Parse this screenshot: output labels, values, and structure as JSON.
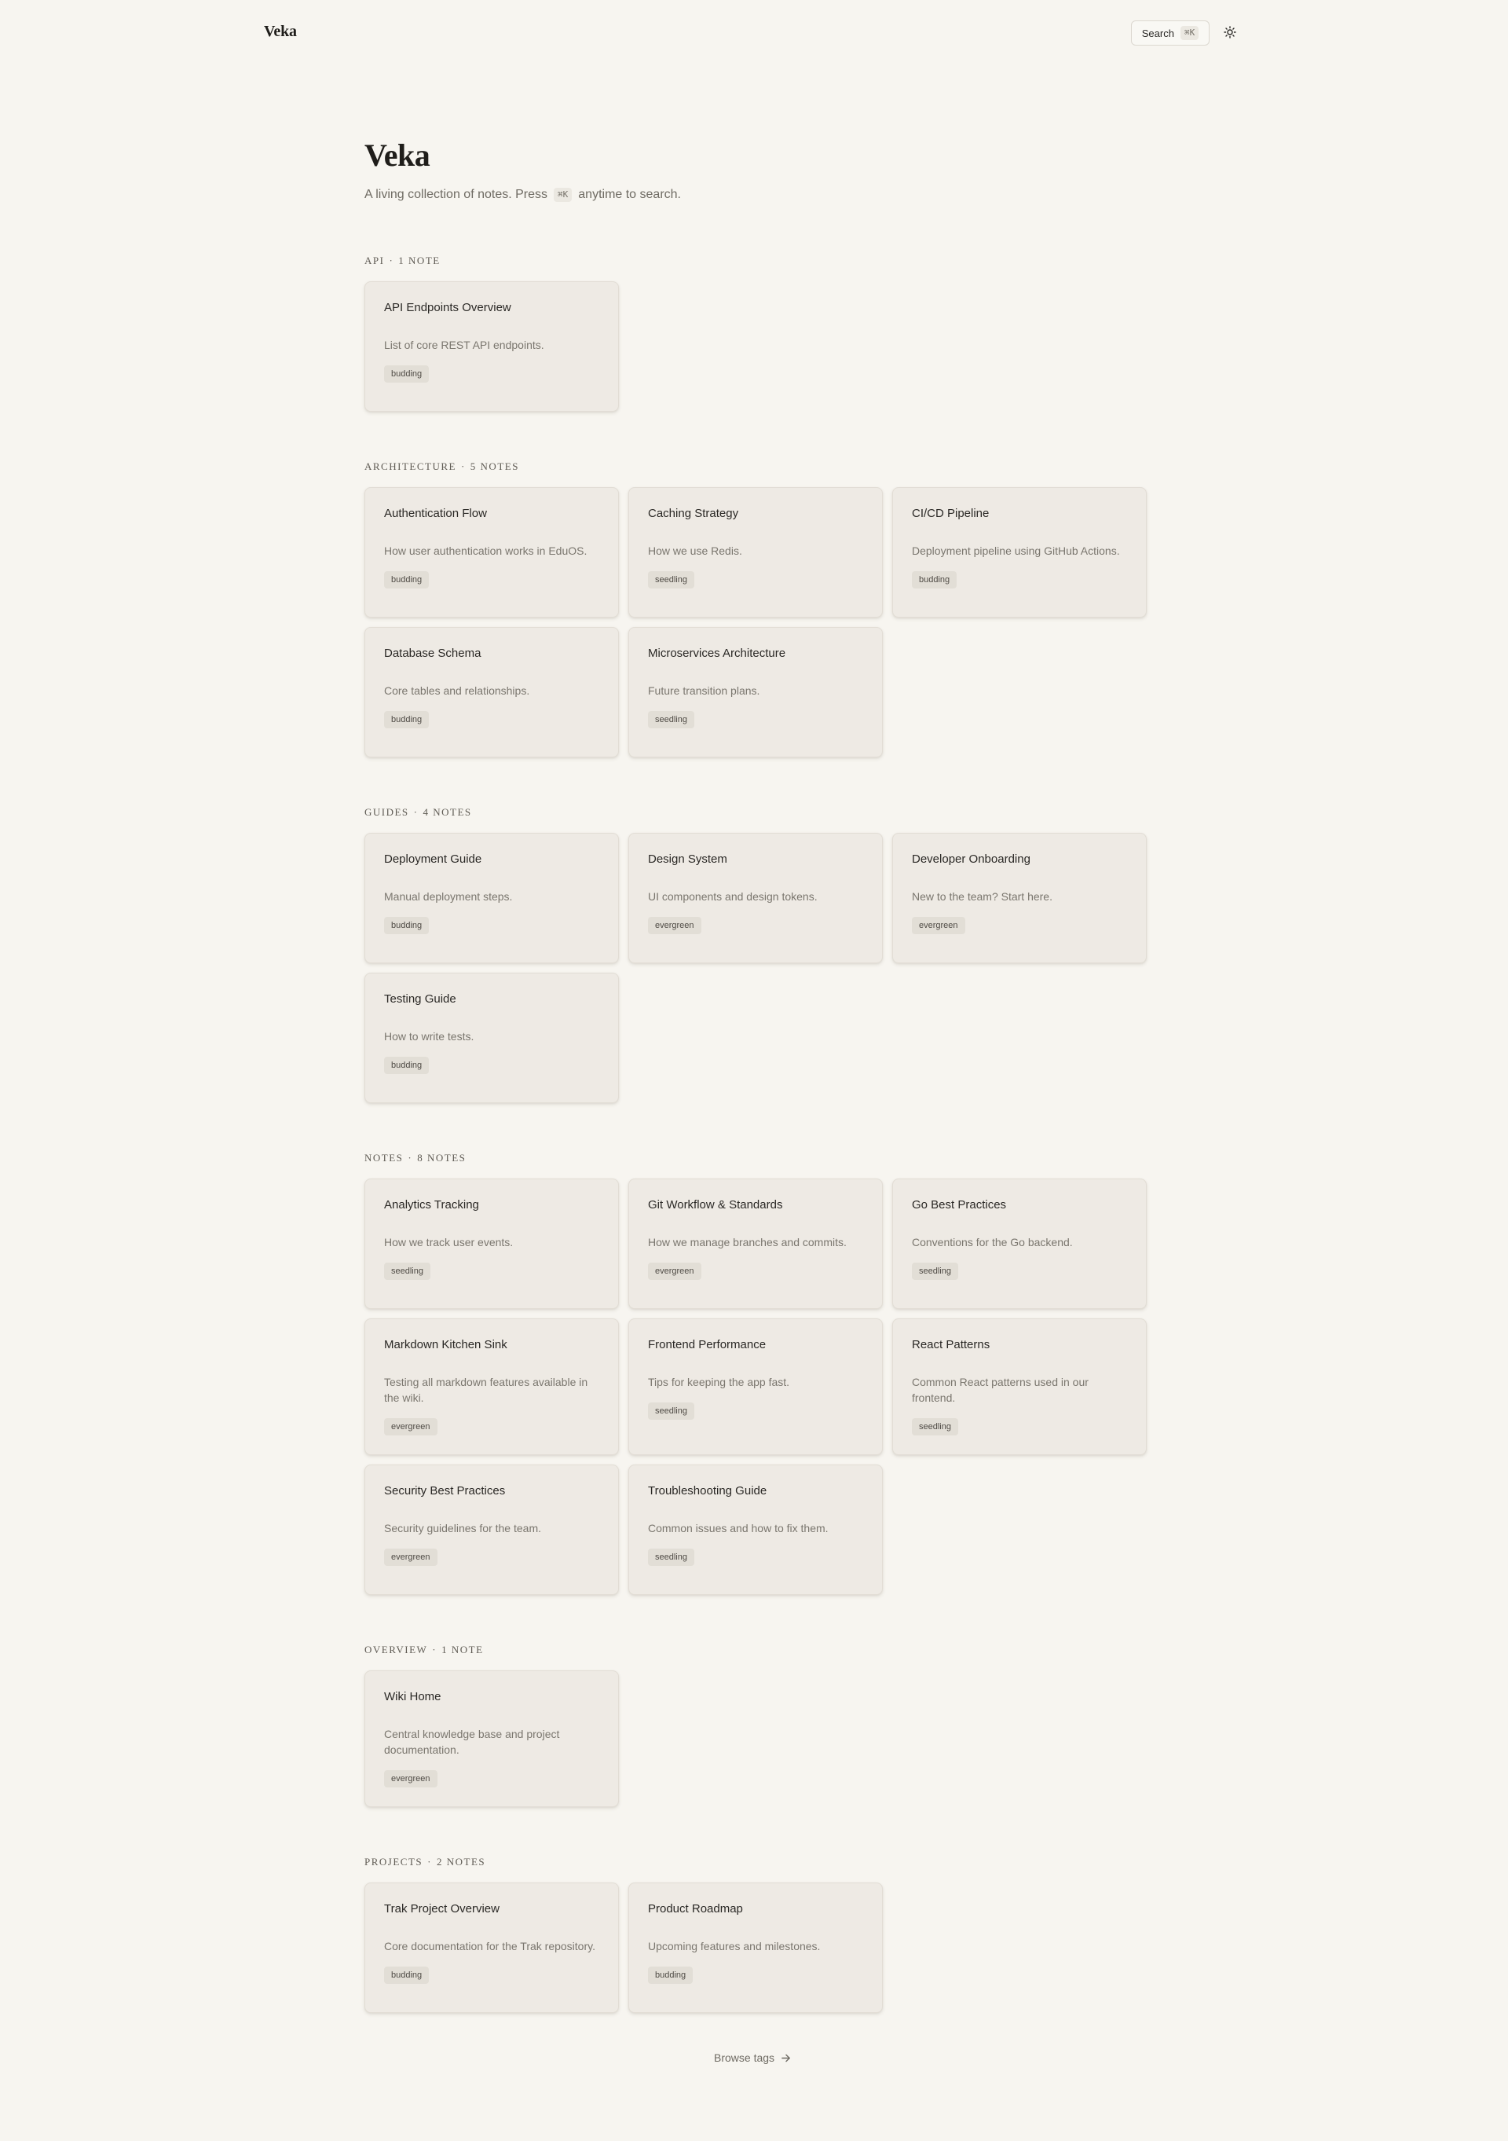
{
  "header": {
    "brand": "Veka",
    "search_label": "Search",
    "search_shortcut": "⌘K",
    "theme_icon": "sun-icon"
  },
  "hero": {
    "title": "Veka",
    "subtitle_before": "A living collection of notes. Press",
    "subtitle_shortcut": "⌘K",
    "subtitle_after": "anytime to search."
  },
  "groups": [
    {
      "name": "API",
      "count": "1 NOTE",
      "notes": [
        {
          "title": "API Endpoints Overview",
          "description": "List of core REST API endpoints.",
          "tag": "budding"
        }
      ]
    },
    {
      "name": "ARCHITECTURE",
      "count": "5 NOTES",
      "notes": [
        {
          "title": "Authentication Flow",
          "description": "How user authentication works in EduOS.",
          "tag": "budding"
        },
        {
          "title": "Caching Strategy",
          "description": "How we use Redis.",
          "tag": "seedling"
        },
        {
          "title": "CI/CD Pipeline",
          "description": "Deployment pipeline using GitHub Actions.",
          "tag": "budding"
        },
        {
          "title": "Database Schema",
          "description": "Core tables and relationships.",
          "tag": "budding"
        },
        {
          "title": "Microservices Architecture",
          "description": "Future transition plans.",
          "tag": "seedling"
        }
      ]
    },
    {
      "name": "GUIDES",
      "count": "4 NOTES",
      "notes": [
        {
          "title": "Deployment Guide",
          "description": "Manual deployment steps.",
          "tag": "budding"
        },
        {
          "title": "Design System",
          "description": "UI components and design tokens.",
          "tag": "evergreen"
        },
        {
          "title": "Developer Onboarding",
          "description": "New to the team? Start here.",
          "tag": "evergreen"
        },
        {
          "title": "Testing Guide",
          "description": "How to write tests.",
          "tag": "budding"
        }
      ]
    },
    {
      "name": "NOTES",
      "count": "8 NOTES",
      "notes": [
        {
          "title": "Analytics Tracking",
          "description": "How we track user events.",
          "tag": "seedling"
        },
        {
          "title": "Git Workflow & Standards",
          "description": "How we manage branches and commits.",
          "tag": "evergreen"
        },
        {
          "title": "Go Best Practices",
          "description": "Conventions for the Go backend.",
          "tag": "seedling"
        },
        {
          "title": "Markdown Kitchen Sink",
          "description": "Testing all markdown features available in the wiki.",
          "tag": "evergreen"
        },
        {
          "title": "Frontend Performance",
          "description": "Tips for keeping the app fast.",
          "tag": "seedling"
        },
        {
          "title": "React Patterns",
          "description": "Common React patterns used in our frontend.",
          "tag": "seedling"
        },
        {
          "title": "Security Best Practices",
          "description": "Security guidelines for the team.",
          "tag": "evergreen"
        },
        {
          "title": "Troubleshooting Guide",
          "description": "Common issues and how to fix them.",
          "tag": "seedling"
        }
      ]
    },
    {
      "name": "OVERVIEW",
      "count": "1 NOTE",
      "notes": [
        {
          "title": "Wiki Home",
          "description": "Central knowledge base and project documentation.",
          "tag": "evergreen"
        }
      ]
    },
    {
      "name": "PROJECTS",
      "count": "2 NOTES",
      "notes": [
        {
          "title": "Trak Project Overview",
          "description": "Core documentation for the Trak repository.",
          "tag": "budding"
        },
        {
          "title": "Product Roadmap",
          "description": "Upcoming features and milestones.",
          "tag": "budding"
        }
      ]
    }
  ],
  "footer": {
    "browse_tags_label": "Browse tags",
    "arrow_icon": "arrow-right-icon"
  }
}
